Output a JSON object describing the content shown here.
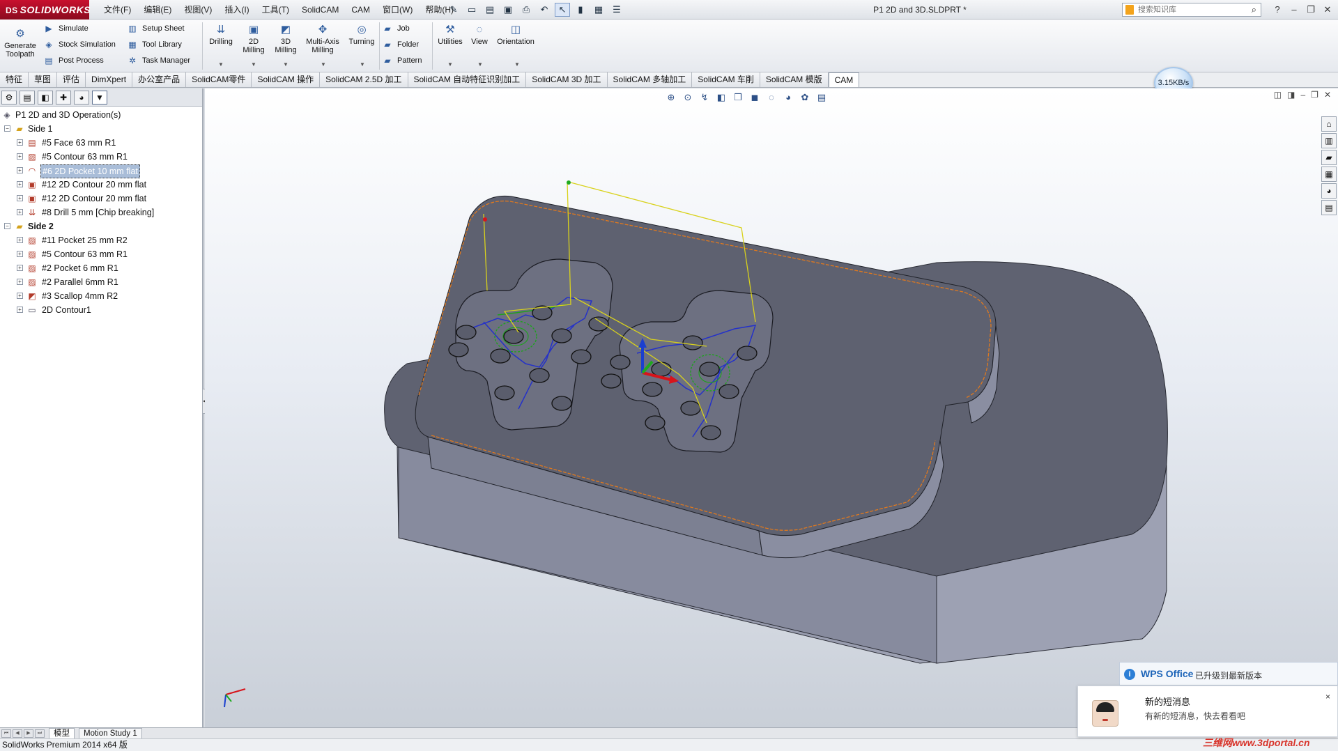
{
  "app": {
    "brand": "SOLIDWORKS",
    "document_title": "P1 2D and 3D.SLDPRT *",
    "menu": [
      "文件(F)",
      "编辑(E)",
      "视图(V)",
      "插入(I)",
      "工具(T)",
      "SolidCAM",
      "CAM",
      "窗口(W)",
      "帮助(H)"
    ],
    "search_placeholder": "搜索知识库"
  },
  "ribbon": {
    "generate_toolpath": "Generate Toolpath",
    "simulate": "Simulate",
    "stock_simulation": "Stock Simulation",
    "post_process": "Post Process",
    "setup_sheet": "Setup Sheet",
    "tool_library": "Tool Library",
    "task_manager": "Task Manager",
    "drilling": "Drilling",
    "milling_2d": "2D Milling",
    "milling_3d": "3D Milling",
    "multi_axis": "Multi-Axis Milling",
    "turning": "Turning",
    "job": "Job",
    "folder": "Folder",
    "pattern": "Pattern",
    "utilities": "Utilities",
    "view": "View",
    "orientation": "Orientation"
  },
  "tabs": [
    "特征",
    "草图",
    "评估",
    "DimXpert",
    "办公室产品",
    "SolidCAM零件",
    "SolidCAM 操作",
    "SolidCAM 2.5D 加工",
    "SolidCAM 自动特征识别加工",
    "SolidCAM 3D 加工",
    "SolidCAM 多轴加工",
    "SolidCAM 车削",
    "SolidCAM 模版",
    "CAM"
  ],
  "net_speed": "3.15KB/s",
  "tree": {
    "root": "P1 2D and 3D Operation(s)",
    "side1": {
      "label": "Side 1",
      "items": [
        "#5 Face 63 mm R1",
        "#5 Contour 63 mm R1",
        "#6 2D Pocket 10 mm flat",
        "#12 2D Contour 20 mm flat",
        "#12 2D Contour 20 mm flat",
        "#8 Drill 5 mm [Chip breaking]"
      ]
    },
    "side2": {
      "label": "Side 2",
      "items": [
        "#11 Pocket 25 mm R2",
        "#5 Contour 63 mm R1",
        "#2 Pocket 6 mm R1",
        "#2 Parallel 6mm R1",
        "#3 Scallop 4mm R2",
        "2D Contour1"
      ]
    }
  },
  "bottom_tabs": [
    "模型",
    "Motion Study 1"
  ],
  "status": "SolidWorks Premium 2014 x64 版",
  "notifications": {
    "wps_brand": "WPS Office",
    "wps_msg": "已升级到最新版本",
    "sms_title": "新的短消息",
    "sms_body": "有新的短消息，快去看看吧",
    "close": "×"
  },
  "watermark": "三维网www.3dportal.cn"
}
